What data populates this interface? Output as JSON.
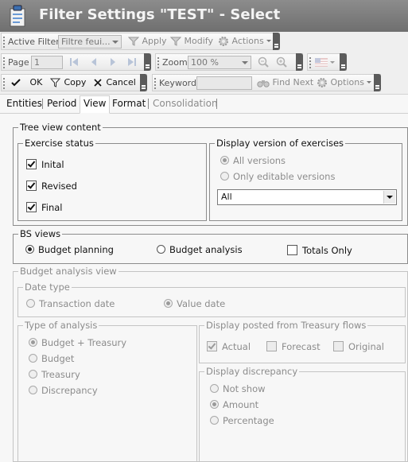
{
  "window": {
    "title": "Filter Settings \"TEST\" - Select",
    "icon": "filter-settings-icon"
  },
  "toolbar1": {
    "active_filter_label": "Active Filter",
    "active_filter_value": "Filtre feui...",
    "apply_label": "Apply",
    "modify_label": "Modify",
    "actions_label": "Actions"
  },
  "toolbar2": {
    "page_label": "Page",
    "page_value": "1",
    "zoom_label": "Zoom",
    "zoom_value": "100 %"
  },
  "toolbar3": {
    "ok_label": "OK",
    "copy_label": "Copy",
    "cancel_label": "Cancel",
    "keyword_label": "Keyword",
    "keyword_value": "",
    "find_next_label": "Find Next",
    "options_label": "Options"
  },
  "tabs": [
    {
      "label": "Entities",
      "state": "normal"
    },
    {
      "label": "Period",
      "state": "normal"
    },
    {
      "label": "View",
      "state": "active"
    },
    {
      "label": "Format",
      "state": "normal"
    },
    {
      "label": "Consolidation",
      "state": "disabled"
    }
  ],
  "tree_view": {
    "title": "Tree view content",
    "exercise_status": {
      "title": "Exercise status",
      "items": [
        {
          "label": "Inital",
          "checked": true
        },
        {
          "label": "Revised",
          "checked": true
        },
        {
          "label": "Final",
          "checked": true
        }
      ]
    },
    "display_version": {
      "title": "Display version of exercises",
      "options": [
        {
          "label": "All versions",
          "selected": true
        },
        {
          "label": "Only editable versions",
          "selected": false
        }
      ],
      "select_value": "All"
    }
  },
  "bs_views": {
    "title": "BS views",
    "budget_planning": "Budget planning",
    "budget_analysis": "Budget analysis",
    "totals_only": "Totals Only"
  },
  "budget_analysis_view": {
    "title": "Budget analysis view",
    "date_type": {
      "title": "Date type",
      "transaction_date": "Transaction date",
      "value_date": "Value date"
    },
    "type_of_analysis": {
      "title": "Type of analysis",
      "options": [
        "Budget + Treasury",
        "Budget",
        "Treasury",
        "Discrepancy"
      ]
    },
    "display_posted": {
      "title": "Display posted from Treasury flows",
      "items": [
        {
          "label": "Actual",
          "checked": true
        },
        {
          "label": "Forecast",
          "checked": false
        },
        {
          "label": "Original",
          "checked": false
        }
      ]
    },
    "display_discrepancy": {
      "title": "Display discrepancy",
      "options": [
        "Not show",
        "Amount",
        "Percentage"
      ]
    }
  }
}
